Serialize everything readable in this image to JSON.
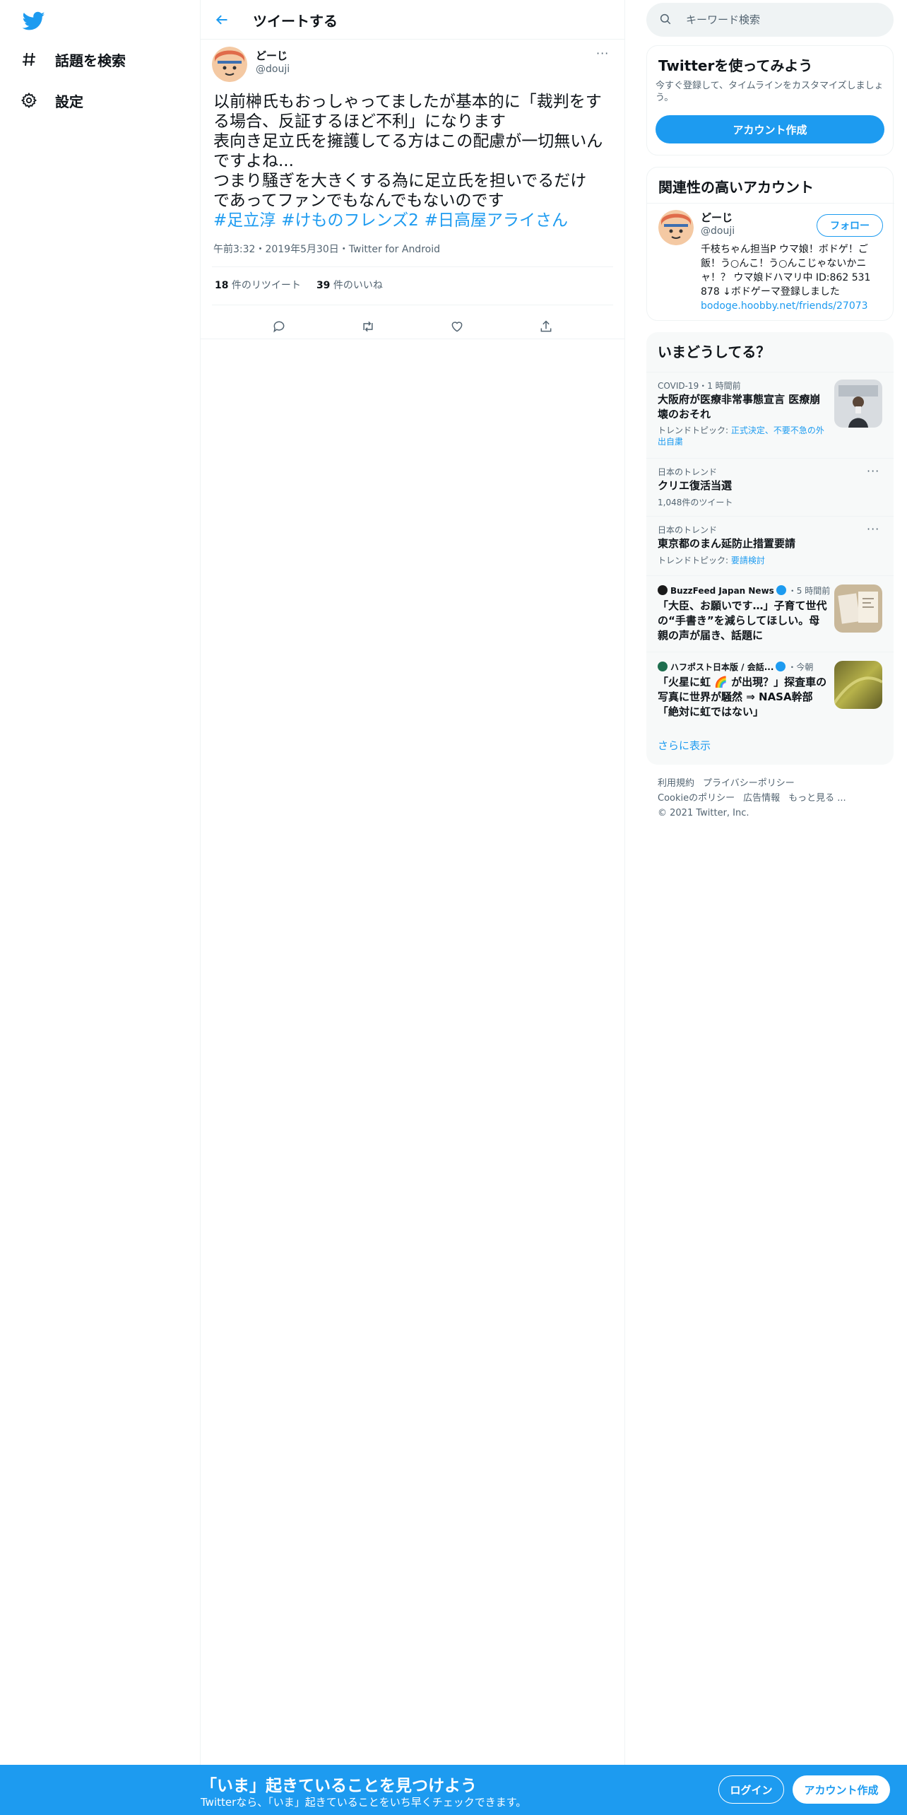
{
  "colors": {
    "accent": "#1d9bf0",
    "text": "#0f1419",
    "muted": "#536471",
    "border": "#eff3f4",
    "panel": "#f7f9f9"
  },
  "nav": {
    "logo_icon": "twitter-bird-icon",
    "items": [
      {
        "icon": "hashtag-icon",
        "label": "話題を検索"
      },
      {
        "icon": "gear-icon",
        "label": "設定"
      }
    ]
  },
  "header": {
    "title": "ツイートする",
    "back_icon": "back-arrow-icon"
  },
  "tweet": {
    "author_name": "どーじ",
    "author_handle": "@douji",
    "more_label": "···",
    "lines": [
      "以前榊氏もおっしゃってましたが基本的に「裁判をす",
      "る場合、反証するほど不利」になります",
      "表向き足立氏を擁護してる方はこの配慮が一切無いん",
      "ですよね...",
      "つまり騒ぎを大きくする為に足立氏を担いでるだけ",
      "であってファンでもなんでもないのです"
    ],
    "hashtags": [
      "#足立淳",
      "#けものフレンズ2",
      "#日高屋アライさん"
    ],
    "meta": "午前3:32・2019年5月30日・Twitter for Android",
    "retweets_count": "18",
    "retweets_label": " 件のリツイート",
    "likes_count": "39",
    "likes_label": " 件のいいね",
    "actions": [
      "reply-icon",
      "retweet-icon",
      "like-icon",
      "share-icon"
    ]
  },
  "search": {
    "placeholder": "キーワード検索",
    "icon": "search-icon"
  },
  "signup_card": {
    "title": "Twitterを使ってみよう",
    "subtitle": "今すぐ登録して、タイムラインをカスタマイズしましょう。",
    "button": "アカウント作成"
  },
  "related": {
    "title": "関連性の高いアカウント",
    "name": "どーじ",
    "handle": "@douji",
    "follow": "フォロー",
    "bio": "千枝ちゃん担当P ウマ娘！ボドゲ！ご飯！う○んこ！う○んこじゃないかニャ！？ ウマ娘ドハマリ中 ID:862 531 878 ↓ボドゲーマ登録しました",
    "link": "bodoge.hoobby.net/friends/27073"
  },
  "trends": {
    "title": "いまどうしてる？",
    "items": [
      {
        "category": "COVID-19・1 時間前",
        "title": "大阪府が医療非常事態宣言 医療崩壊のおそれ",
        "sub_prefix": "トレンドトピック: ",
        "sub_link": "正式決定、不要不急の外出自粛"
      },
      {
        "category": "日本のトレンド",
        "title": "クリエ復活当選",
        "sub": "1,048件のツイート",
        "more": "···"
      },
      {
        "category": "日本のトレンド",
        "title": "東京都のまん延防止措置要請",
        "sub_prefix": "トレンドトピック: ",
        "sub_link": "要請検討",
        "more": "···"
      },
      {
        "source": "BuzzFeed Japan News",
        "time": "・5 時間前",
        "title": "「大臣、お願いです…」子育て世代の“手書き”を減らしてほしい。母親の声が届き、話題に"
      },
      {
        "source": "ハフポスト日本版 / 会話...",
        "time": "・今朝",
        "title": "「火星に虹 🌈 が出現？」探査車の写真に世界が騒然 ⇒ NASA幹部「絶対に虹ではない」"
      }
    ],
    "show_more": "さらに表示"
  },
  "footer": {
    "links": [
      "利用規約",
      "プライバシーポリシー",
      "Cookieのポリシー",
      "広告情報",
      "もっと見る ..."
    ],
    "copyright": "© 2021 Twitter, Inc."
  },
  "banner": {
    "title": "「いま」起きていることを見つけよう",
    "subtitle": "Twitterなら、「いま」起きていることをいち早くチェックできます。",
    "login": "ログイン",
    "signup": "アカウント作成"
  }
}
